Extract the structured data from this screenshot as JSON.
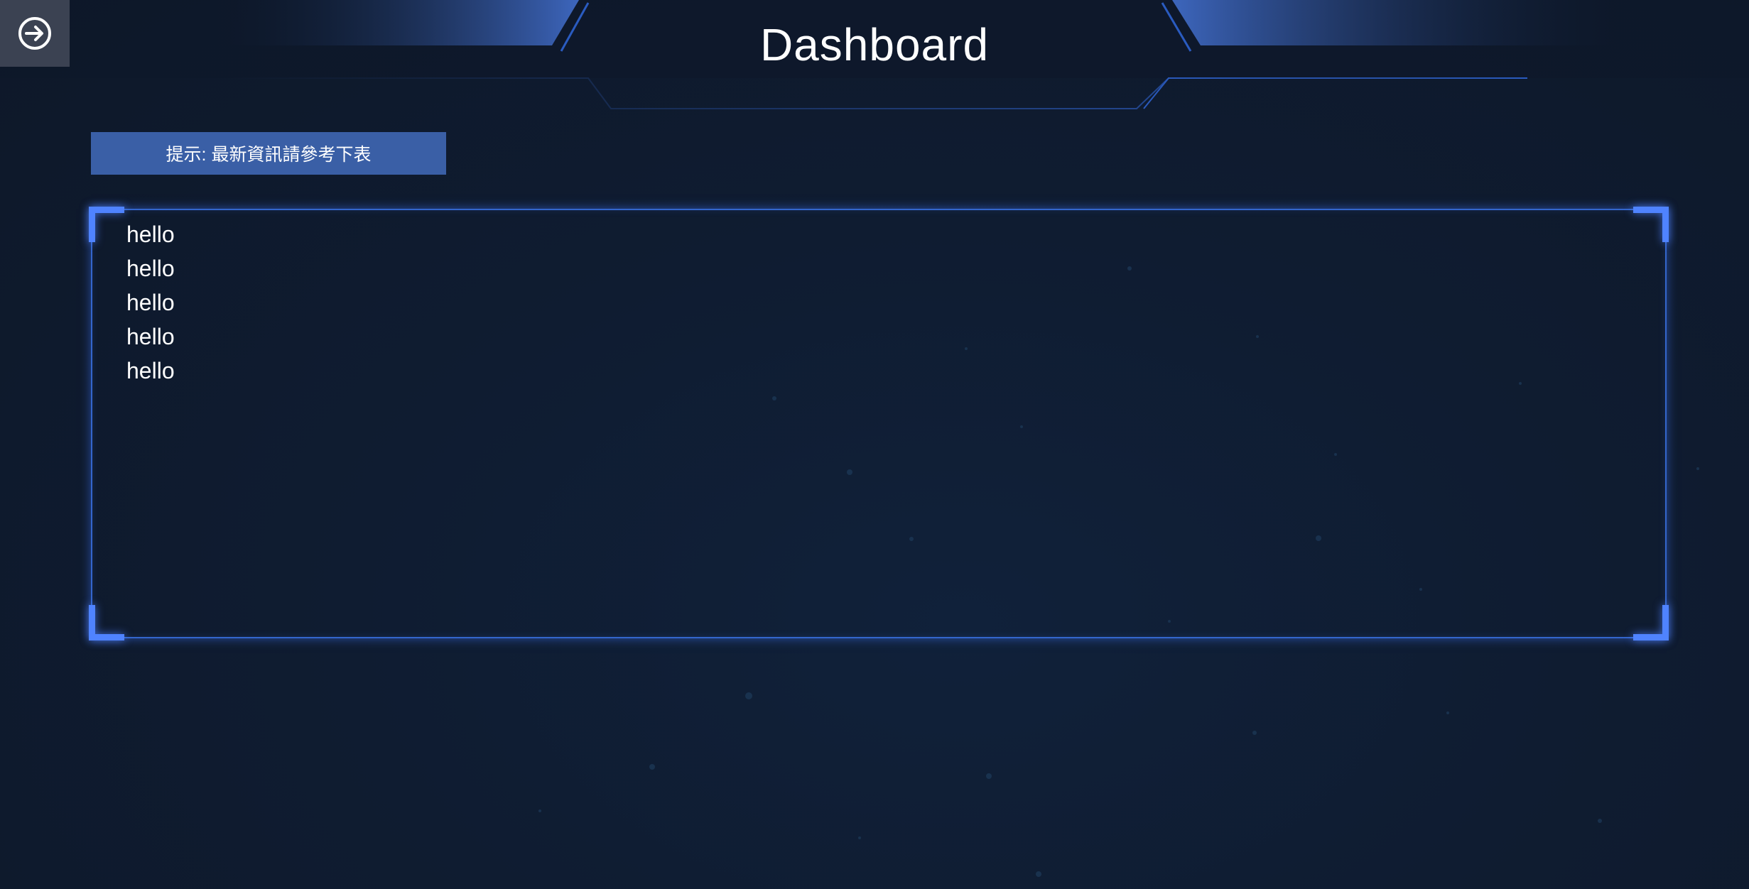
{
  "header": {
    "title": "Dashboard"
  },
  "exit_button": {
    "icon": "arrow-right-circle-icon"
  },
  "notice": {
    "text": "提示: 最新資訊請參考下表"
  },
  "panel": {
    "items": [
      "hello",
      "hello",
      "hello",
      "hello",
      "hello"
    ]
  },
  "colors": {
    "background": "#0f1a2d",
    "accent": "#4f83ff",
    "banner": "#3a5fa6"
  }
}
